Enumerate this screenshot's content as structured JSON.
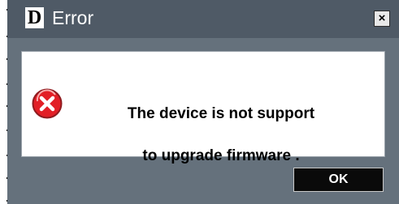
{
  "window": {
    "title": "Error",
    "logo_letter": "D",
    "close_glyph": "×"
  },
  "message": {
    "line1": "The device is not support",
    "line2": " to upgrade firmware ."
  },
  "icons": {
    "error": "error-x-icon",
    "close": "close-icon",
    "logo": "d-logo-icon"
  },
  "buttons": {
    "ok_label": "OK"
  },
  "colors": {
    "frame": "#65717c",
    "titlebar": "#4f5a66",
    "panel": "#ffffff",
    "error_red": "#e21f26",
    "ok_button": "#0a0a0a"
  }
}
